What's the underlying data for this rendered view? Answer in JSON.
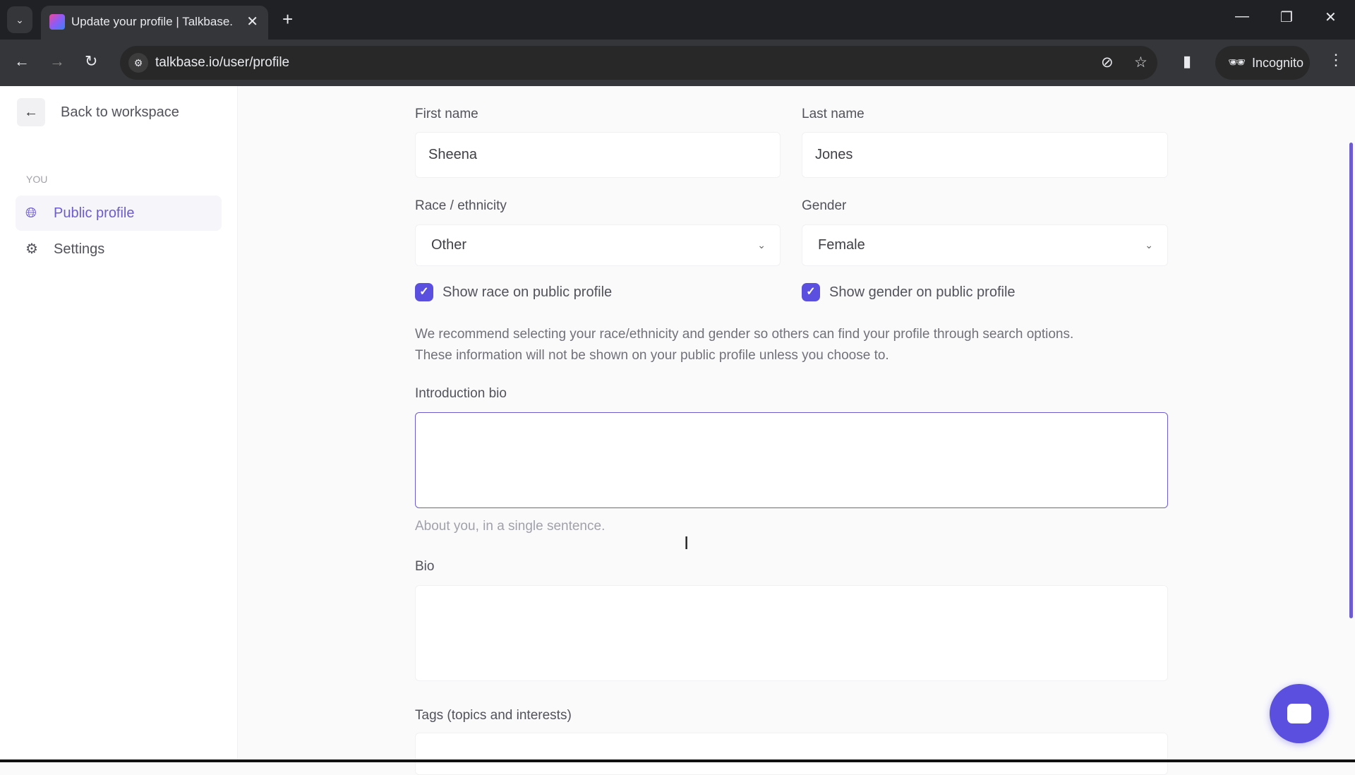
{
  "browser": {
    "tab_title": "Update your profile | Talkbase.io",
    "url": "talkbase.io/user/profile",
    "incognito_label": "Incognito"
  },
  "sidebar": {
    "back_label": "Back to workspace",
    "section": "YOU",
    "items": [
      {
        "label": "Public profile",
        "icon": "globe-icon",
        "active": true
      },
      {
        "label": "Settings",
        "icon": "gear-icon",
        "active": false
      }
    ]
  },
  "form": {
    "first_name": {
      "label": "First name",
      "value": "Sheena"
    },
    "last_name": {
      "label": "Last name",
      "value": "Jones"
    },
    "race": {
      "label": "Race / ethnicity",
      "value": "Other",
      "checkbox_label": "Show race on public profile",
      "checked": true
    },
    "gender": {
      "label": "Gender",
      "value": "Female",
      "checkbox_label": "Show gender on public profile",
      "checked": true
    },
    "recommend_line1": "We recommend selecting your race/ethnicity and gender so others can find your profile through search options.",
    "recommend_line2": "These information will not be shown on your public profile unless you choose to.",
    "intro_bio": {
      "label": "Introduction bio",
      "value": "",
      "help": "About you, in a single sentence."
    },
    "bio": {
      "label": "Bio",
      "value": ""
    },
    "tags": {
      "label": "Tags (topics and interests)"
    }
  },
  "colors": {
    "accent": "#5b4fe0"
  }
}
